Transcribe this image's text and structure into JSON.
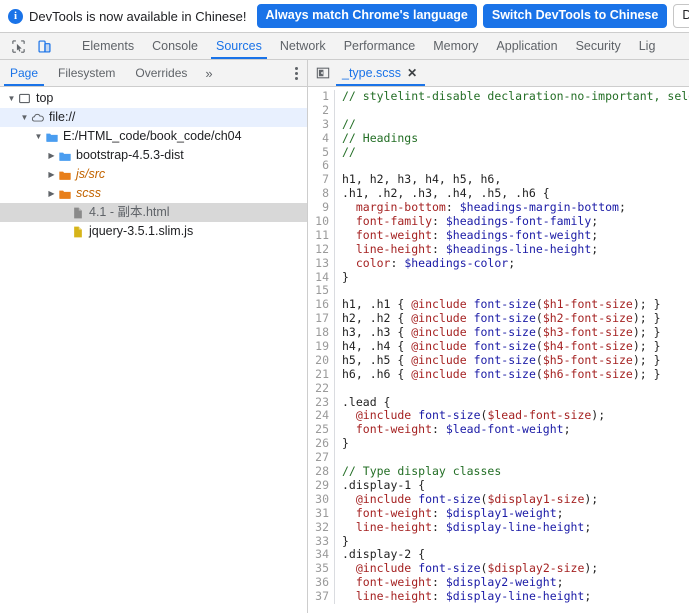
{
  "banner": {
    "icon": "info-icon",
    "message": "DevTools is now available in Chinese!",
    "buttons": [
      {
        "label": "Always match Chrome's language",
        "style": "primary"
      },
      {
        "label": "Switch DevTools to Chinese",
        "style": "primary"
      },
      {
        "label": "Don't show again",
        "style": "secondary"
      }
    ],
    "accent_color": "#1a73e8"
  },
  "main_toolbar": {
    "icons": [
      {
        "name": "inspect-element-icon",
        "active": false
      },
      {
        "name": "device-toolbar-icon",
        "active": true
      }
    ],
    "tabs": [
      {
        "label": "Elements",
        "active": false
      },
      {
        "label": "Console",
        "active": false
      },
      {
        "label": "Sources",
        "active": true
      },
      {
        "label": "Network",
        "active": false
      },
      {
        "label": "Performance",
        "active": false
      },
      {
        "label": "Memory",
        "active": false
      },
      {
        "label": "Application",
        "active": false
      },
      {
        "label": "Security",
        "active": false
      },
      {
        "label": "Lig",
        "active": false
      }
    ]
  },
  "navigator": {
    "tabs": [
      {
        "label": "Page",
        "active": true
      },
      {
        "label": "Filesystem",
        "active": false
      },
      {
        "label": "Overrides",
        "active": false
      }
    ],
    "more_label": "»",
    "menu_label": "More options",
    "tree": [
      {
        "label": "top",
        "depth": 0,
        "icon": "frame-icon",
        "expanded": true,
        "selected": "none",
        "style": "plain"
      },
      {
        "label": "file://",
        "depth": 1,
        "icon": "cloud-icon",
        "expanded": true,
        "selected": "blue",
        "style": "plain"
      },
      {
        "label": "E:/HTML_code/book_code/ch04",
        "depth": 2,
        "icon": "folder-blue-icon",
        "expanded": true,
        "selected": "none",
        "style": "plain"
      },
      {
        "label": "bootstrap-4.5.3-dist",
        "depth": 3,
        "icon": "folder-blue-icon",
        "expanded": false,
        "selected": "none",
        "style": "plain"
      },
      {
        "label": "js/src",
        "depth": 3,
        "icon": "folder-orange-icon",
        "expanded": false,
        "selected": "none",
        "style": "italic"
      },
      {
        "label": "scss",
        "depth": 3,
        "icon": "folder-orange-icon",
        "expanded": false,
        "selected": "none",
        "style": "italic"
      },
      {
        "label": "4.1 - 副本.html",
        "depth": 4,
        "icon": "file-document-icon",
        "expanded": null,
        "selected": "gray",
        "style": "cjk"
      },
      {
        "label": "jquery-3.5.1.slim.js",
        "depth": 4,
        "icon": "file-js-icon",
        "expanded": null,
        "selected": "none",
        "style": "plain"
      }
    ]
  },
  "editor": {
    "panel_toggle_icon": "show-navigator-icon",
    "open_file_tab": {
      "label": "_type.scss",
      "close_icon": "close-icon",
      "active": true
    },
    "first_line_number": 1,
    "lines": [
      {
        "n": 1,
        "tokens": [
          {
            "t": "// stylelint-disable declaration-no-important, sele",
            "c": "cm"
          }
        ]
      },
      {
        "n": 2,
        "tokens": []
      },
      {
        "n": 3,
        "tokens": [
          {
            "t": "//",
            "c": "cm"
          }
        ]
      },
      {
        "n": 4,
        "tokens": [
          {
            "t": "// Headings",
            "c": "cm"
          }
        ]
      },
      {
        "n": 5,
        "tokens": [
          {
            "t": "//",
            "c": "cm"
          }
        ]
      },
      {
        "n": 6,
        "tokens": []
      },
      {
        "n": 7,
        "tokens": [
          {
            "t": "h1, h2, h3, h4, h5, h6,",
            "c": "sel"
          }
        ]
      },
      {
        "n": 8,
        "tokens": [
          {
            "t": ".h1, .h2, .h3, .h4, .h5, .h6 {",
            "c": "sel"
          }
        ]
      },
      {
        "n": 9,
        "tokens": [
          {
            "t": "  margin-bottom",
            "c": "prop"
          },
          {
            "t": ": ",
            "c": "pl"
          },
          {
            "t": "$headings-margin-bottom",
            "c": "var"
          },
          {
            "t": ";",
            "c": "pl"
          }
        ]
      },
      {
        "n": 10,
        "tokens": [
          {
            "t": "  font-family",
            "c": "prop"
          },
          {
            "t": ": ",
            "c": "pl"
          },
          {
            "t": "$headings-font-family",
            "c": "var"
          },
          {
            "t": ";",
            "c": "pl"
          }
        ]
      },
      {
        "n": 11,
        "tokens": [
          {
            "t": "  font-weight",
            "c": "prop"
          },
          {
            "t": ": ",
            "c": "pl"
          },
          {
            "t": "$headings-font-weight",
            "c": "var"
          },
          {
            "t": ";",
            "c": "pl"
          }
        ]
      },
      {
        "n": 12,
        "tokens": [
          {
            "t": "  line-height",
            "c": "prop"
          },
          {
            "t": ": ",
            "c": "pl"
          },
          {
            "t": "$headings-line-height",
            "c": "var"
          },
          {
            "t": ";",
            "c": "pl"
          }
        ]
      },
      {
        "n": 13,
        "tokens": [
          {
            "t": "  color",
            "c": "prop"
          },
          {
            "t": ": ",
            "c": "pl"
          },
          {
            "t": "$headings-color",
            "c": "var"
          },
          {
            "t": ";",
            "c": "pl"
          }
        ]
      },
      {
        "n": 14,
        "tokens": [
          {
            "t": "}",
            "c": "sel"
          }
        ]
      },
      {
        "n": 15,
        "tokens": []
      },
      {
        "n": 16,
        "tokens": [
          {
            "t": "h1, .h1 { ",
            "c": "sel"
          },
          {
            "t": "@include",
            "c": "at"
          },
          {
            "t": " ",
            "c": "pl"
          },
          {
            "t": "font-size",
            "c": "fn"
          },
          {
            "t": "(",
            "c": "pl"
          },
          {
            "t": "$h1-font-size",
            "c": "prop"
          },
          {
            "t": "); }",
            "c": "pl"
          }
        ]
      },
      {
        "n": 17,
        "tokens": [
          {
            "t": "h2, .h2 { ",
            "c": "sel"
          },
          {
            "t": "@include",
            "c": "at"
          },
          {
            "t": " ",
            "c": "pl"
          },
          {
            "t": "font-size",
            "c": "fn"
          },
          {
            "t": "(",
            "c": "pl"
          },
          {
            "t": "$h2-font-size",
            "c": "prop"
          },
          {
            "t": "); }",
            "c": "pl"
          }
        ]
      },
      {
        "n": 18,
        "tokens": [
          {
            "t": "h3, .h3 { ",
            "c": "sel"
          },
          {
            "t": "@include",
            "c": "at"
          },
          {
            "t": " ",
            "c": "pl"
          },
          {
            "t": "font-size",
            "c": "fn"
          },
          {
            "t": "(",
            "c": "pl"
          },
          {
            "t": "$h3-font-size",
            "c": "prop"
          },
          {
            "t": "); }",
            "c": "pl"
          }
        ]
      },
      {
        "n": 19,
        "tokens": [
          {
            "t": "h4, .h4 { ",
            "c": "sel"
          },
          {
            "t": "@include",
            "c": "at"
          },
          {
            "t": " ",
            "c": "pl"
          },
          {
            "t": "font-size",
            "c": "fn"
          },
          {
            "t": "(",
            "c": "pl"
          },
          {
            "t": "$h4-font-size",
            "c": "prop"
          },
          {
            "t": "); }",
            "c": "pl"
          }
        ]
      },
      {
        "n": 20,
        "tokens": [
          {
            "t": "h5, .h5 { ",
            "c": "sel"
          },
          {
            "t": "@include",
            "c": "at"
          },
          {
            "t": " ",
            "c": "pl"
          },
          {
            "t": "font-size",
            "c": "fn"
          },
          {
            "t": "(",
            "c": "pl"
          },
          {
            "t": "$h5-font-size",
            "c": "prop"
          },
          {
            "t": "); }",
            "c": "pl"
          }
        ]
      },
      {
        "n": 21,
        "tokens": [
          {
            "t": "h6, .h6 { ",
            "c": "sel"
          },
          {
            "t": "@include",
            "c": "at"
          },
          {
            "t": " ",
            "c": "pl"
          },
          {
            "t": "font-size",
            "c": "fn"
          },
          {
            "t": "(",
            "c": "pl"
          },
          {
            "t": "$h6-font-size",
            "c": "prop"
          },
          {
            "t": "); }",
            "c": "pl"
          }
        ]
      },
      {
        "n": 22,
        "tokens": []
      },
      {
        "n": 23,
        "tokens": [
          {
            "t": ".lead {",
            "c": "sel"
          }
        ]
      },
      {
        "n": 24,
        "tokens": [
          {
            "t": "  @include",
            "c": "at"
          },
          {
            "t": " ",
            "c": "pl"
          },
          {
            "t": "font-size",
            "c": "fn"
          },
          {
            "t": "(",
            "c": "pl"
          },
          {
            "t": "$lead-font-size",
            "c": "prop"
          },
          {
            "t": ");",
            "c": "pl"
          }
        ]
      },
      {
        "n": 25,
        "tokens": [
          {
            "t": "  font-weight",
            "c": "prop"
          },
          {
            "t": ": ",
            "c": "pl"
          },
          {
            "t": "$lead-font-weight",
            "c": "var"
          },
          {
            "t": ";",
            "c": "pl"
          }
        ]
      },
      {
        "n": 26,
        "tokens": [
          {
            "t": "}",
            "c": "sel"
          }
        ]
      },
      {
        "n": 27,
        "tokens": []
      },
      {
        "n": 28,
        "tokens": [
          {
            "t": "// Type display classes",
            "c": "cm"
          }
        ]
      },
      {
        "n": 29,
        "tokens": [
          {
            "t": ".display-1 {",
            "c": "sel"
          }
        ]
      },
      {
        "n": 30,
        "tokens": [
          {
            "t": "  @include",
            "c": "at"
          },
          {
            "t": " ",
            "c": "pl"
          },
          {
            "t": "font-size",
            "c": "fn"
          },
          {
            "t": "(",
            "c": "pl"
          },
          {
            "t": "$display1-size",
            "c": "prop"
          },
          {
            "t": ");",
            "c": "pl"
          }
        ]
      },
      {
        "n": 31,
        "tokens": [
          {
            "t": "  font-weight",
            "c": "prop"
          },
          {
            "t": ": ",
            "c": "pl"
          },
          {
            "t": "$display1-weight",
            "c": "var"
          },
          {
            "t": ";",
            "c": "pl"
          }
        ]
      },
      {
        "n": 32,
        "tokens": [
          {
            "t": "  line-height",
            "c": "prop"
          },
          {
            "t": ": ",
            "c": "pl"
          },
          {
            "t": "$display-line-height",
            "c": "var"
          },
          {
            "t": ";",
            "c": "pl"
          }
        ]
      },
      {
        "n": 33,
        "tokens": [
          {
            "t": "}",
            "c": "sel"
          }
        ]
      },
      {
        "n": 34,
        "tokens": [
          {
            "t": ".display-2 {",
            "c": "sel"
          }
        ]
      },
      {
        "n": 35,
        "tokens": [
          {
            "t": "  @include",
            "c": "at"
          },
          {
            "t": " ",
            "c": "pl"
          },
          {
            "t": "font-size",
            "c": "fn"
          },
          {
            "t": "(",
            "c": "pl"
          },
          {
            "t": "$display2-size",
            "c": "prop"
          },
          {
            "t": ");",
            "c": "pl"
          }
        ]
      },
      {
        "n": 36,
        "tokens": [
          {
            "t": "  font-weight",
            "c": "prop"
          },
          {
            "t": ": ",
            "c": "pl"
          },
          {
            "t": "$display2-weight",
            "c": "var"
          },
          {
            "t": ";",
            "c": "pl"
          }
        ]
      },
      {
        "n": 37,
        "tokens": [
          {
            "t": "  line-height",
            "c": "prop"
          },
          {
            "t": ": ",
            "c": "pl"
          },
          {
            "t": "$display-line-height",
            "c": "var"
          },
          {
            "t": ";",
            "c": "pl"
          }
        ]
      }
    ],
    "syntax_colors": {
      "comment": "#236e25",
      "selector": "#222222",
      "property": "#a52222",
      "variable": "#1a1aa6",
      "gutter": "#9a9a9a"
    }
  }
}
